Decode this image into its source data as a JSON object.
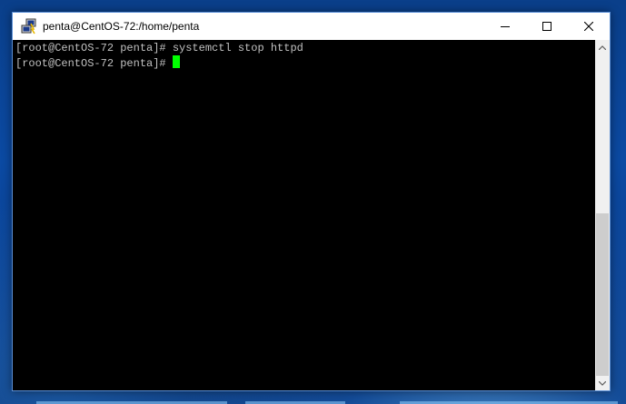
{
  "window": {
    "title": "penta@CentOS-72:/home/penta"
  },
  "terminal": {
    "lines": [
      {
        "prompt": "[root@CentOS-72 penta]# ",
        "command": "systemctl stop httpd"
      },
      {
        "prompt": "[root@CentOS-72 penta]# ",
        "command": ""
      }
    ],
    "cursor_color": "#00ff00"
  },
  "scrollbar": {
    "position_fraction": 1.0
  },
  "icons": {
    "app": "putty-icon",
    "minimize": "minimize-icon",
    "maximize": "maximize-icon",
    "close": "close-icon"
  }
}
